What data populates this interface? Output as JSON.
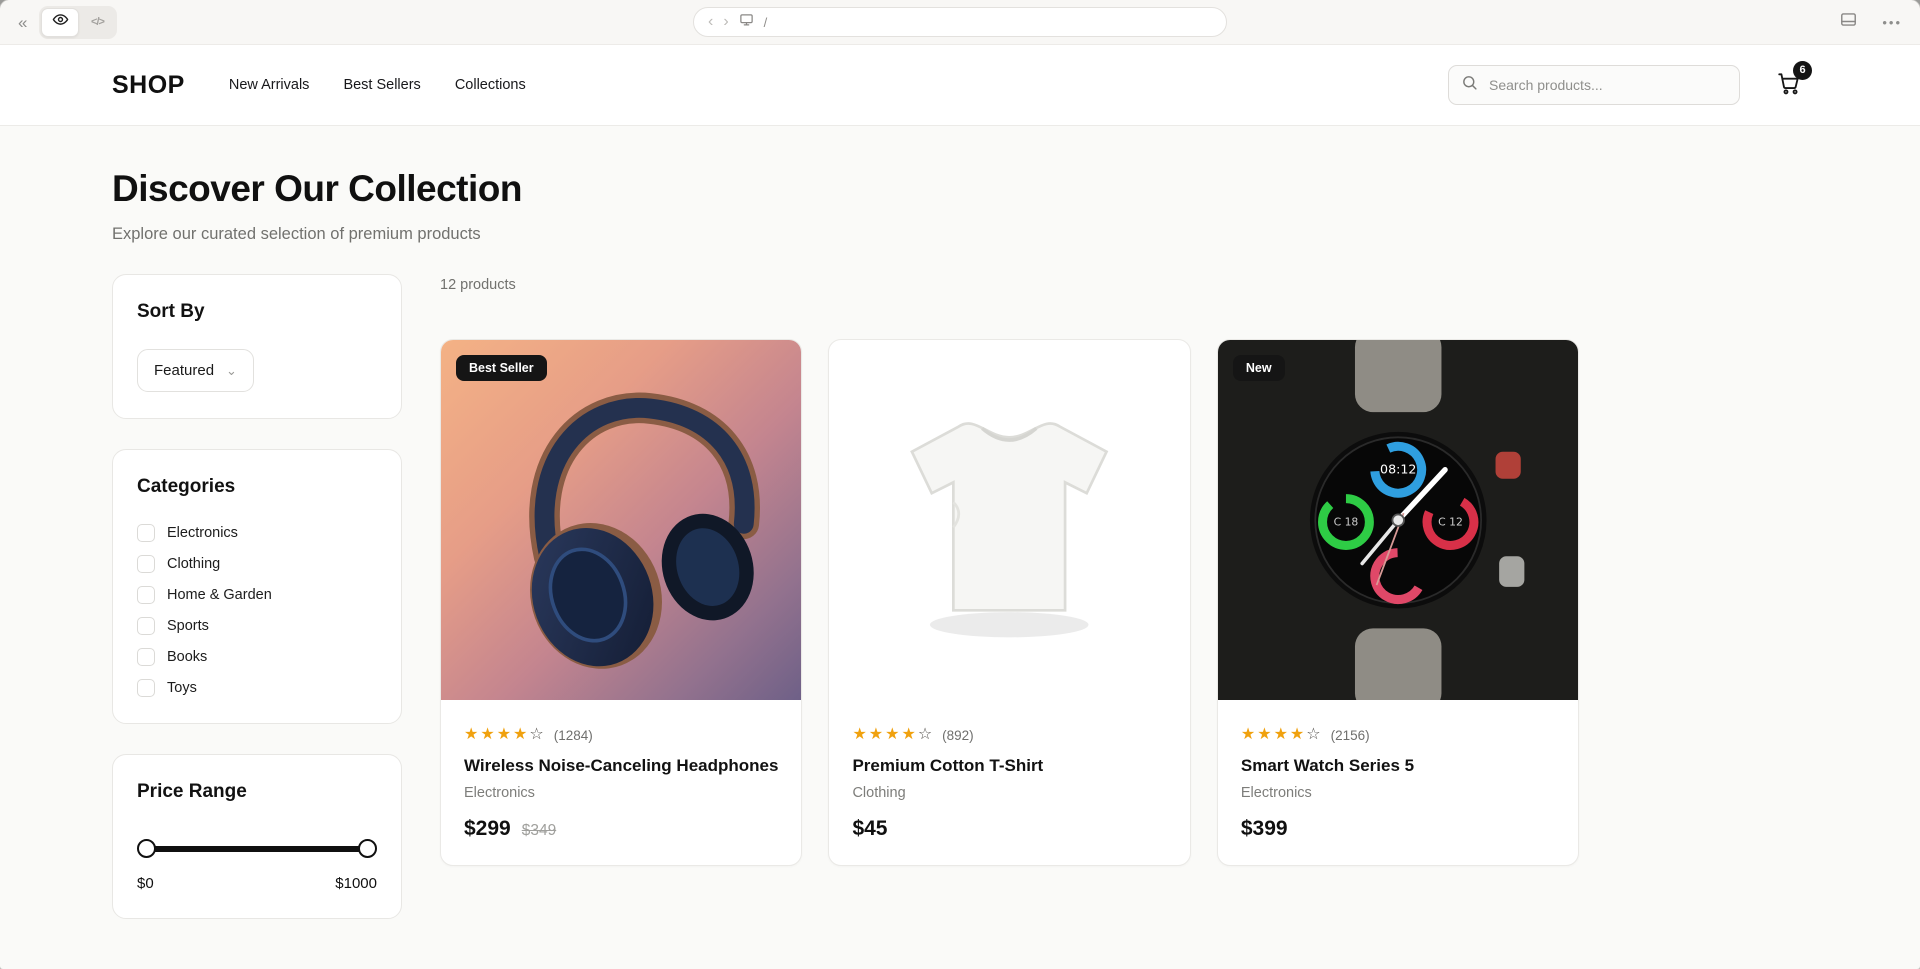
{
  "browser_chrome": {
    "icons": {
      "collapse": "«",
      "back": "‹",
      "forward": "›",
      "code": "</>",
      "ellipsis": "•••"
    },
    "address": {
      "path": "/"
    }
  },
  "header": {
    "logo": "SHOP",
    "nav": [
      "New Arrivals",
      "Best Sellers",
      "Collections"
    ],
    "search_placeholder": "Search products...",
    "cart_count": "6"
  },
  "hero": {
    "title": "Discover Our Collection",
    "subtitle": "Explore our curated selection of premium products"
  },
  "sidebar": {
    "sort": {
      "title": "Sort By",
      "selected": "Featured",
      "caret": "⌄"
    },
    "categories": {
      "title": "Categories",
      "options": [
        "Electronics",
        "Clothing",
        "Home & Garden",
        "Sports",
        "Books",
        "Toys"
      ]
    },
    "price": {
      "title": "Price Range",
      "min_label": "$0",
      "max_label": "$1000"
    }
  },
  "products": {
    "count_label": "12 products",
    "items": [
      {
        "badge": "Best Seller",
        "title": "Wireless Noise-Canceling Headphones",
        "category": "Electronics",
        "price": "$299",
        "original_price": "$349",
        "rating": 4,
        "rating_max": 5,
        "reviews": "(1284)",
        "image": "headphones"
      },
      {
        "badge": null,
        "title": "Premium Cotton T-Shirt",
        "category": "Clothing",
        "price": "$45",
        "original_price": null,
        "rating": 4,
        "rating_max": 5,
        "reviews": "(892)",
        "image": "tshirt"
      },
      {
        "badge": "New",
        "title": "Smart Watch Series 5",
        "category": "Electronics",
        "price": "$399",
        "original_price": null,
        "rating": 4,
        "rating_max": 5,
        "reviews": "(2156)",
        "image": "watch"
      }
    ]
  },
  "colors": {
    "star": "#f0a10e",
    "badge_bg": "#151515",
    "accent": "#101010",
    "page_bg": "#fafaf8"
  }
}
